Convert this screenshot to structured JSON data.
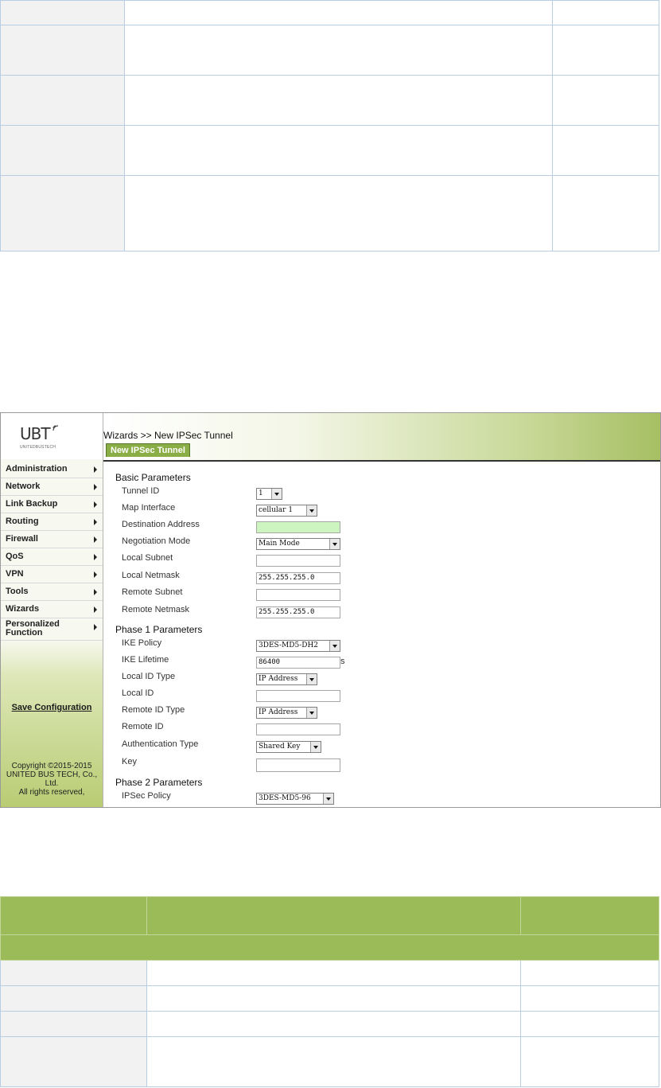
{
  "screenshot": {
    "logo": {
      "text": "UBT",
      "subtext": "UNITEDBUSTECH"
    },
    "menu": [
      {
        "label": "Administration"
      },
      {
        "label": "Network"
      },
      {
        "label": "Link Backup"
      },
      {
        "label": "Routing"
      },
      {
        "label": "Firewall"
      },
      {
        "label": "QoS"
      },
      {
        "label": "VPN"
      },
      {
        "label": "Tools"
      },
      {
        "label": "Wizards"
      },
      {
        "label": "Personalized Function"
      }
    ],
    "save_label": "Save Configuration",
    "copyright": [
      "Copyright ©2015-2015",
      "UNITED BUS TECH, Co.,",
      "Ltd.",
      "All rights reserved,"
    ],
    "breadcrumb": "Wizards >> New IPSec Tunnel",
    "tab": "New IPSec Tunnel",
    "sections": {
      "basic": "Basic Parameters",
      "phase1": "Phase 1 Parameters",
      "phase2": "Phase 2 Parameters"
    },
    "fields": {
      "tunnel_id": {
        "label": "Tunnel ID",
        "value": "1"
      },
      "map_interface": {
        "label": "Map Interface",
        "value": "cellular 1"
      },
      "destination_address": {
        "label": "Destination Address",
        "value": ""
      },
      "negotiation_mode": {
        "label": "Negotiation Mode",
        "value": "Main Mode"
      },
      "local_subnet": {
        "label": "Local Subnet",
        "value": ""
      },
      "local_netmask": {
        "label": "Local Netmask",
        "value": "255.255.255.0"
      },
      "remote_subnet": {
        "label": "Remote Subnet",
        "value": ""
      },
      "remote_netmask": {
        "label": "Remote Netmask",
        "value": "255.255.255.0"
      },
      "ike_policy": {
        "label": "IKE Policy",
        "value": "3DES-MD5-DH2"
      },
      "ike_lifetime": {
        "label": "IKE Lifetime",
        "value": "86400",
        "unit": "s"
      },
      "local_id_type": {
        "label": "Local ID Type",
        "value": "IP Address"
      },
      "local_id": {
        "label": "Local ID",
        "value": ""
      },
      "remote_id_type": {
        "label": "Remote ID Type",
        "value": "IP Address"
      },
      "remote_id": {
        "label": "Remote ID",
        "value": ""
      },
      "auth_type": {
        "label": "Authentication Type",
        "value": "Shared Key"
      },
      "key": {
        "label": "Key",
        "value": ""
      },
      "ipsec_policy": {
        "label": "IPSec Policy",
        "value": "3DES-MD5-96"
      }
    }
  },
  "colors": {
    "table_border": "#b8cce4",
    "table_header_green": "#9bbb59",
    "tab_green": "#8aae45",
    "required_field": "#ccf5c0"
  }
}
